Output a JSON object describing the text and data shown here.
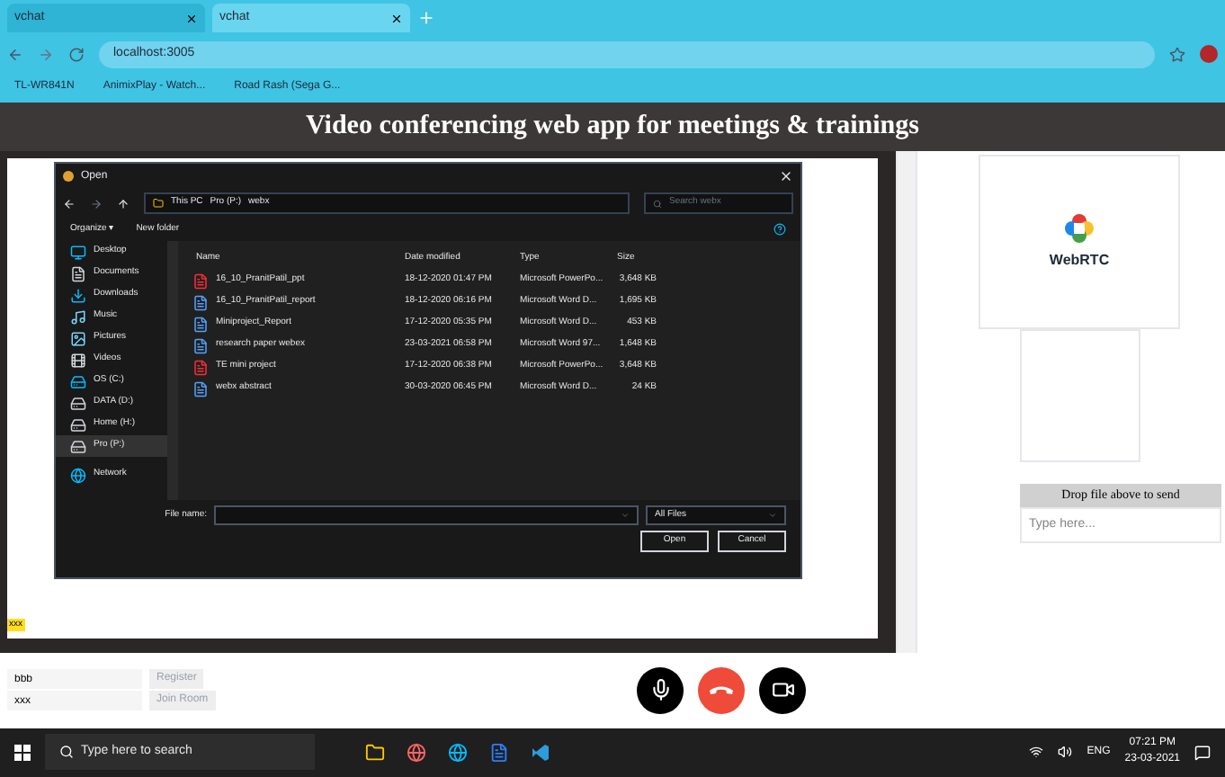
{
  "browser": {
    "tabs": [
      {
        "title": "vchat",
        "selected": false
      },
      {
        "title": "vchat",
        "selected": true
      }
    ],
    "address": "localhost:3005",
    "bookmarks": [
      "TL-WR841N",
      "AnimixPlay - Watch...",
      "Road Rash (Sega G..."
    ]
  },
  "app": {
    "title": "Video conferencing web app for meetings & trainings",
    "video_label": "xxx",
    "logo_text": "WebRTC",
    "drop_label": "Drop file above to send",
    "message_placeholder": "Type here..."
  },
  "dialog": {
    "title": "Open",
    "breadcrumb": [
      "This PC",
      "Pro (P:)",
      "webx"
    ],
    "search_placeholder": "Search webx",
    "toolbar": [
      "Organize ▾",
      "New folder"
    ],
    "nav": [
      {
        "label": "Desktop",
        "kind": "desktop",
        "selected": false
      },
      {
        "label": "Documents",
        "kind": "doc",
        "selected": false
      },
      {
        "label": "Downloads",
        "kind": "down",
        "selected": false
      },
      {
        "label": "Music",
        "kind": "music",
        "selected": false
      },
      {
        "label": "Pictures",
        "kind": "pic",
        "selected": false
      },
      {
        "label": "Videos",
        "kind": "video",
        "selected": false
      },
      {
        "label": "OS (C:)",
        "kind": "disk",
        "selected": false
      },
      {
        "label": "DATA (D:)",
        "kind": "drive",
        "selected": false
      },
      {
        "label": "Home (H:)",
        "kind": "drive",
        "selected": false
      },
      {
        "label": "Pro (P:)",
        "kind": "drive",
        "selected": true
      },
      {
        "label": "Network",
        "kind": "network",
        "selected": false
      }
    ],
    "columns": [
      "Name",
      "Date modified",
      "Type",
      "Size"
    ],
    "files": [
      {
        "name": "16_10_PranitPatil_ppt",
        "date": "18-12-2020 01:47 PM",
        "type": "Microsoft PowerPo...",
        "size": "3,648 KB",
        "kind": "ppt"
      },
      {
        "name": "16_10_PranitPatil_report",
        "date": "18-12-2020 06:16 PM",
        "type": "Microsoft Word D...",
        "size": "1,695 KB",
        "kind": "word"
      },
      {
        "name": "Miniproject_Report",
        "date": "17-12-2020 05:35 PM",
        "type": "Microsoft Word D...",
        "size": "453 KB",
        "kind": "word"
      },
      {
        "name": "research paper webex",
        "date": "23-03-2021 06:58 PM",
        "type": "Microsoft Word 97...",
        "size": "1,648 KB",
        "kind": "word"
      },
      {
        "name": "TE mini project",
        "date": "17-12-2020 06:38 PM",
        "type": "Microsoft PowerPo...",
        "size": "3,648 KB",
        "kind": "ppt"
      },
      {
        "name": "webx abstract",
        "date": "30-03-2020 06:45 PM",
        "type": "Microsoft Word D...",
        "size": "24 KB",
        "kind": "word"
      }
    ],
    "file_name_label": "File name:",
    "filter": "All Files",
    "buttons": [
      "Open",
      "Cancel"
    ]
  },
  "room": {
    "fields": [
      {
        "value": "bbb",
        "button": "Register"
      },
      {
        "value": "xxx",
        "button": "Join Room"
      }
    ]
  },
  "taskbar": {
    "search_placeholder": "Type here to search",
    "language": "ENG",
    "time": "07:21 PM",
    "date": "23-03-2021"
  }
}
